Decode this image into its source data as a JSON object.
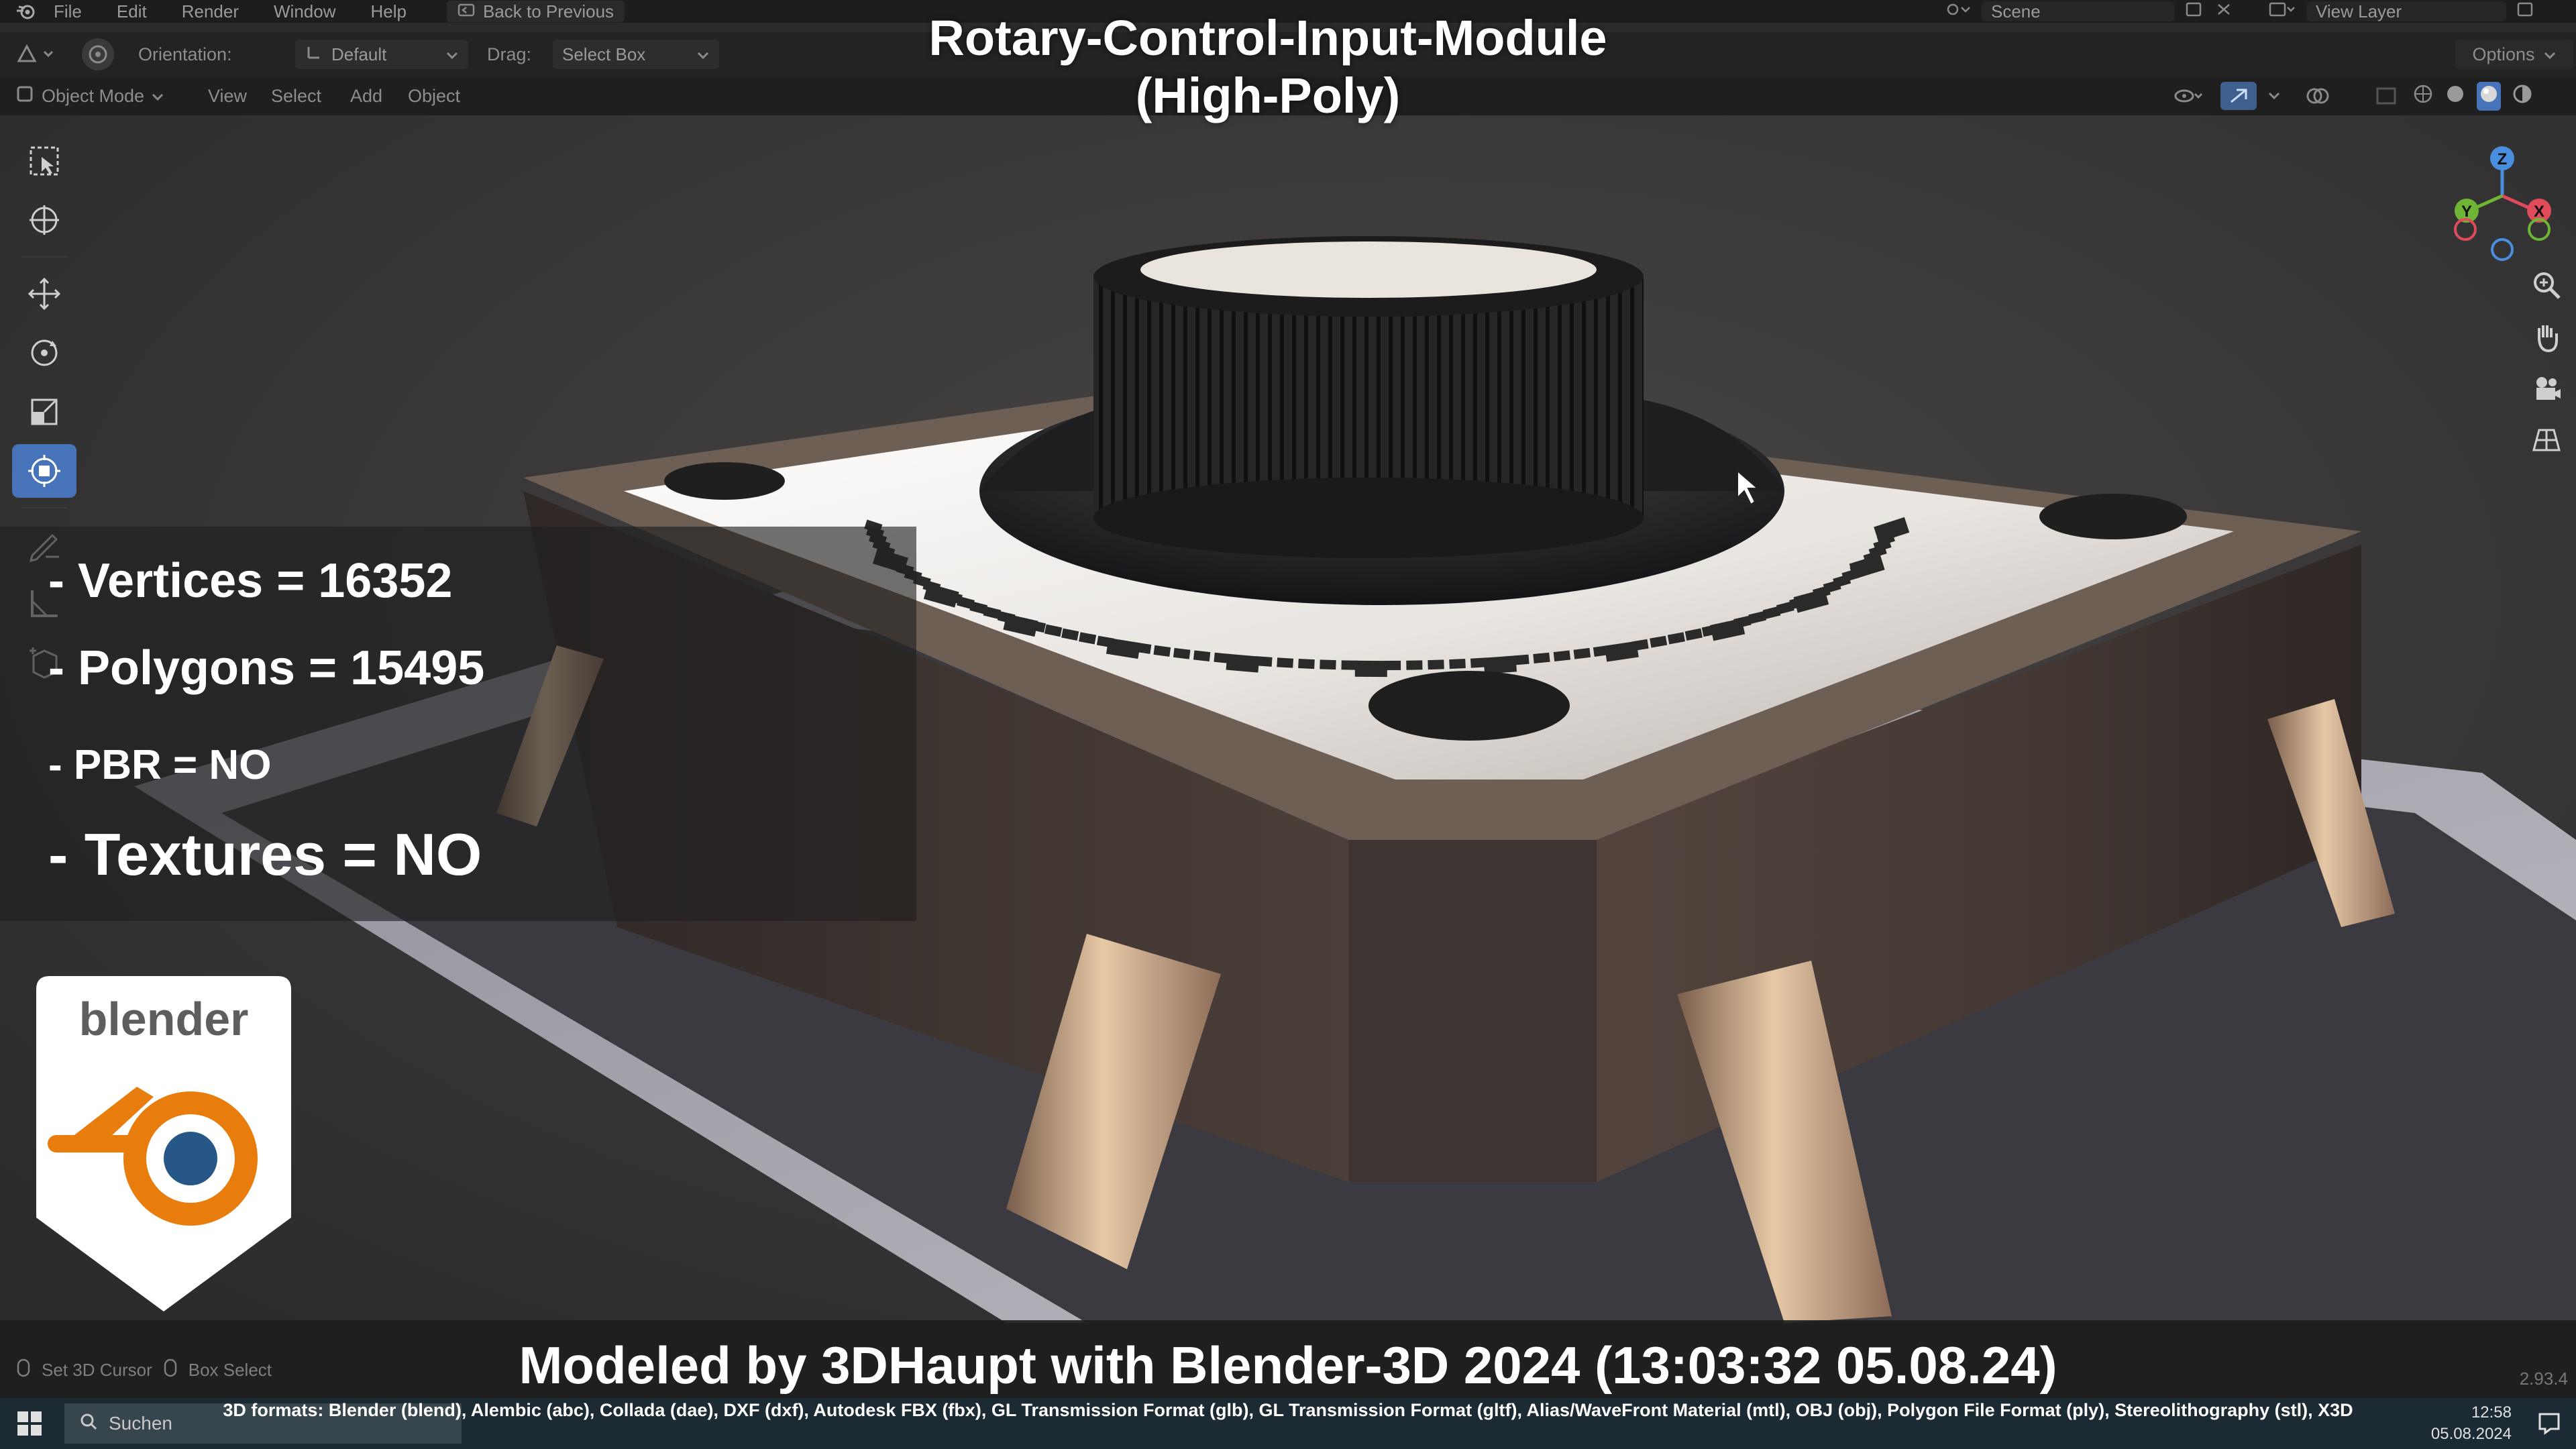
{
  "menu": {
    "items": [
      "File",
      "Edit",
      "Render",
      "Window",
      "Help"
    ],
    "back_label": "Back to Previous",
    "scene_label": "Scene",
    "view_layer_label": "View Layer"
  },
  "tool_settings": {
    "orientation_label": "Orientation:",
    "orientation_value": "Default",
    "drag_label": "Drag:",
    "drag_value": "Select Box",
    "options_label": "Options"
  },
  "viewport_header": {
    "mode_label": "Object Mode",
    "menus": [
      "View",
      "Select",
      "Add",
      "Object"
    ]
  },
  "title": {
    "line1": "Rotary-Control-Input-Module",
    "line2": "(High-Poly)"
  },
  "stats": {
    "vertices": "- Vertices = 16352",
    "polygons": "- Polygons = 15495",
    "pbr": "- PBR =  NO",
    "textures": "- Textures = NO"
  },
  "badge": {
    "word": "blender",
    "accent": "#e87d0d",
    "eye": "#265787"
  },
  "credit": "Modeled by 3DHaupt with Blender-3D 2024 (13:03:32  05.08.24)",
  "formats": "3D formats: Blender (blend), Alembic (abc), Collada (dae), DXF (dxf), Autodesk FBX (fbx), GL Transmission Format (glb), GL Transmission Format (gltf), Alias/WaveFront Material (mtl), OBJ (obj), Polygon File Format (ply), Stereolithography (stl), X3D",
  "statusbar": {
    "set_cursor": "Set 3D Cursor",
    "box_select": "Box Select",
    "version": "2.93.4"
  },
  "taskbar": {
    "search_placeholder": "Suchen",
    "time": "12:58",
    "date": "05.08.2024"
  },
  "gizmo": {
    "x_label": "X",
    "y_label": "Y",
    "z_label": "Z",
    "x_color": "#e04b5b",
    "y_color": "#6fb535",
    "z_color": "#4a8ee0"
  }
}
